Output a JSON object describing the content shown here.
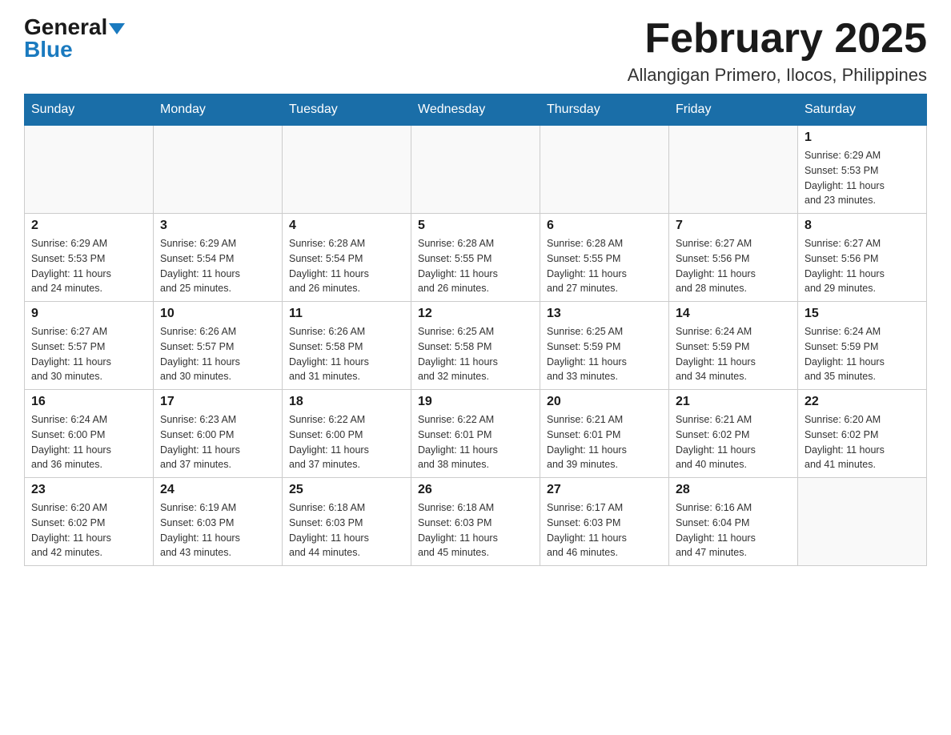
{
  "header": {
    "logo_general": "General",
    "logo_blue": "Blue",
    "title": "February 2025",
    "subtitle": "Allangigan Primero, Ilocos, Philippines"
  },
  "days_of_week": [
    "Sunday",
    "Monday",
    "Tuesday",
    "Wednesday",
    "Thursday",
    "Friday",
    "Saturday"
  ],
  "weeks": [
    {
      "days": [
        {
          "number": "",
          "info": ""
        },
        {
          "number": "",
          "info": ""
        },
        {
          "number": "",
          "info": ""
        },
        {
          "number": "",
          "info": ""
        },
        {
          "number": "",
          "info": ""
        },
        {
          "number": "",
          "info": ""
        },
        {
          "number": "1",
          "info": "Sunrise: 6:29 AM\nSunset: 5:53 PM\nDaylight: 11 hours\nand 23 minutes."
        }
      ]
    },
    {
      "days": [
        {
          "number": "2",
          "info": "Sunrise: 6:29 AM\nSunset: 5:53 PM\nDaylight: 11 hours\nand 24 minutes."
        },
        {
          "number": "3",
          "info": "Sunrise: 6:29 AM\nSunset: 5:54 PM\nDaylight: 11 hours\nand 25 minutes."
        },
        {
          "number": "4",
          "info": "Sunrise: 6:28 AM\nSunset: 5:54 PM\nDaylight: 11 hours\nand 26 minutes."
        },
        {
          "number": "5",
          "info": "Sunrise: 6:28 AM\nSunset: 5:55 PM\nDaylight: 11 hours\nand 26 minutes."
        },
        {
          "number": "6",
          "info": "Sunrise: 6:28 AM\nSunset: 5:55 PM\nDaylight: 11 hours\nand 27 minutes."
        },
        {
          "number": "7",
          "info": "Sunrise: 6:27 AM\nSunset: 5:56 PM\nDaylight: 11 hours\nand 28 minutes."
        },
        {
          "number": "8",
          "info": "Sunrise: 6:27 AM\nSunset: 5:56 PM\nDaylight: 11 hours\nand 29 minutes."
        }
      ]
    },
    {
      "days": [
        {
          "number": "9",
          "info": "Sunrise: 6:27 AM\nSunset: 5:57 PM\nDaylight: 11 hours\nand 30 minutes."
        },
        {
          "number": "10",
          "info": "Sunrise: 6:26 AM\nSunset: 5:57 PM\nDaylight: 11 hours\nand 30 minutes."
        },
        {
          "number": "11",
          "info": "Sunrise: 6:26 AM\nSunset: 5:58 PM\nDaylight: 11 hours\nand 31 minutes."
        },
        {
          "number": "12",
          "info": "Sunrise: 6:25 AM\nSunset: 5:58 PM\nDaylight: 11 hours\nand 32 minutes."
        },
        {
          "number": "13",
          "info": "Sunrise: 6:25 AM\nSunset: 5:59 PM\nDaylight: 11 hours\nand 33 minutes."
        },
        {
          "number": "14",
          "info": "Sunrise: 6:24 AM\nSunset: 5:59 PM\nDaylight: 11 hours\nand 34 minutes."
        },
        {
          "number": "15",
          "info": "Sunrise: 6:24 AM\nSunset: 5:59 PM\nDaylight: 11 hours\nand 35 minutes."
        }
      ]
    },
    {
      "days": [
        {
          "number": "16",
          "info": "Sunrise: 6:24 AM\nSunset: 6:00 PM\nDaylight: 11 hours\nand 36 minutes."
        },
        {
          "number": "17",
          "info": "Sunrise: 6:23 AM\nSunset: 6:00 PM\nDaylight: 11 hours\nand 37 minutes."
        },
        {
          "number": "18",
          "info": "Sunrise: 6:22 AM\nSunset: 6:00 PM\nDaylight: 11 hours\nand 37 minutes."
        },
        {
          "number": "19",
          "info": "Sunrise: 6:22 AM\nSunset: 6:01 PM\nDaylight: 11 hours\nand 38 minutes."
        },
        {
          "number": "20",
          "info": "Sunrise: 6:21 AM\nSunset: 6:01 PM\nDaylight: 11 hours\nand 39 minutes."
        },
        {
          "number": "21",
          "info": "Sunrise: 6:21 AM\nSunset: 6:02 PM\nDaylight: 11 hours\nand 40 minutes."
        },
        {
          "number": "22",
          "info": "Sunrise: 6:20 AM\nSunset: 6:02 PM\nDaylight: 11 hours\nand 41 minutes."
        }
      ]
    },
    {
      "days": [
        {
          "number": "23",
          "info": "Sunrise: 6:20 AM\nSunset: 6:02 PM\nDaylight: 11 hours\nand 42 minutes."
        },
        {
          "number": "24",
          "info": "Sunrise: 6:19 AM\nSunset: 6:03 PM\nDaylight: 11 hours\nand 43 minutes."
        },
        {
          "number": "25",
          "info": "Sunrise: 6:18 AM\nSunset: 6:03 PM\nDaylight: 11 hours\nand 44 minutes."
        },
        {
          "number": "26",
          "info": "Sunrise: 6:18 AM\nSunset: 6:03 PM\nDaylight: 11 hours\nand 45 minutes."
        },
        {
          "number": "27",
          "info": "Sunrise: 6:17 AM\nSunset: 6:03 PM\nDaylight: 11 hours\nand 46 minutes."
        },
        {
          "number": "28",
          "info": "Sunrise: 6:16 AM\nSunset: 6:04 PM\nDaylight: 11 hours\nand 47 minutes."
        },
        {
          "number": "",
          "info": ""
        }
      ]
    }
  ]
}
